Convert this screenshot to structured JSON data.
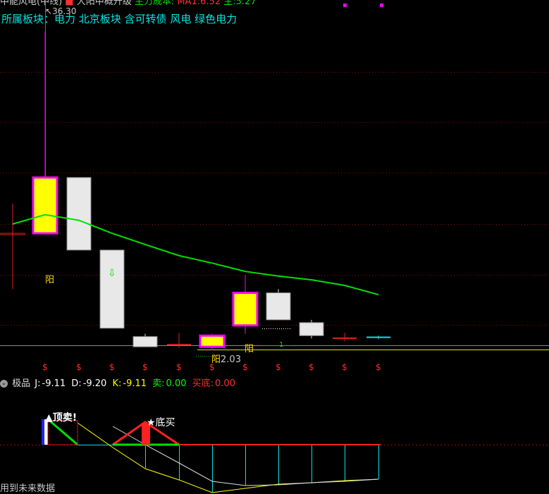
{
  "header": {
    "title_part1": "中能风电(中线)",
    "title_dot": "■",
    "title_part2": "大阳中概升级",
    "title_part3": "主力成本:",
    "title_part4": "MA1:6.52",
    "title_part5": "主:5.27"
  },
  "sector": {
    "label": "所属板块：",
    "items": "电力 北京板块 含可转债 风电 绿色电力"
  },
  "price_chart": {
    "peak_label": "36.30",
    "low_label": "2.03",
    "yang_label": "阳",
    "sell_marker": "$",
    "down_arrow": "⇩",
    "candles": [
      {
        "open": 14.6,
        "close": 14.6,
        "high": 17.8,
        "low": 8.6,
        "style": "hollow-red"
      },
      {
        "open": 14.6,
        "close": 20.6,
        "high": 36.3,
        "low": 14.6,
        "style": "yellow-magenta"
      },
      {
        "open": 20.6,
        "close": 12.8,
        "high": 20.6,
        "low": 12.8,
        "style": "white-grey"
      },
      {
        "open": 12.8,
        "close": 4.4,
        "high": 12.8,
        "low": 4.4,
        "style": "white-grey"
      },
      {
        "open": 3.5,
        "close": 2.4,
        "high": 3.8,
        "low": 2.4,
        "style": "white-grey"
      },
      {
        "open": 2.7,
        "close": 2.5,
        "high": 3.9,
        "low": 2.3,
        "style": "red-doji"
      },
      {
        "open": 2.4,
        "close": 3.6,
        "high": 3.8,
        "low": 2.03,
        "style": "yellow-magenta"
      },
      {
        "open": 4.7,
        "close": 8.2,
        "high": 10.1,
        "low": 3.8,
        "style": "yellow-magenta"
      },
      {
        "open": 8.2,
        "close": 5.3,
        "high": 8.6,
        "low": 5.3,
        "style": "white-grey"
      },
      {
        "open": 5.0,
        "close": 3.6,
        "high": 5.3,
        "low": 3.3,
        "style": "white-grey"
      },
      {
        "open": 3.4,
        "close": 3.3,
        "high": 3.9,
        "low": 3.0,
        "style": "red-doji"
      },
      {
        "open": 3.5,
        "close": 3.3,
        "high": 3.6,
        "low": 3.2,
        "style": "cyan-doji"
      }
    ],
    "ma": [
      15.6,
      16.6,
      16.0,
      14.6,
      13.4,
      12.2,
      11.4,
      10.5,
      10.0,
      9.6,
      9.0,
      8.0
    ],
    "sell_marks_count": 11
  },
  "indicator": {
    "name": "极品",
    "j_label": "J:",
    "j_value": "-9.11",
    "d_label": "D:",
    "d_value": "-9.20",
    "k_label": "K:",
    "k_value": "-9.11",
    "sell_label": "卖:",
    "sell_value": "0.00",
    "buy_label": "买底:",
    "buy_value": "0.00",
    "signal_top": "▲顶卖!",
    "signal_bottom": "★底买",
    "future_note": "用到未来数据",
    "colors": {
      "j": "#ffffff",
      "d": "#ffffff",
      "k": "#ffff00",
      "sell": "#00ff00",
      "buy": "#ff3030"
    }
  }
}
